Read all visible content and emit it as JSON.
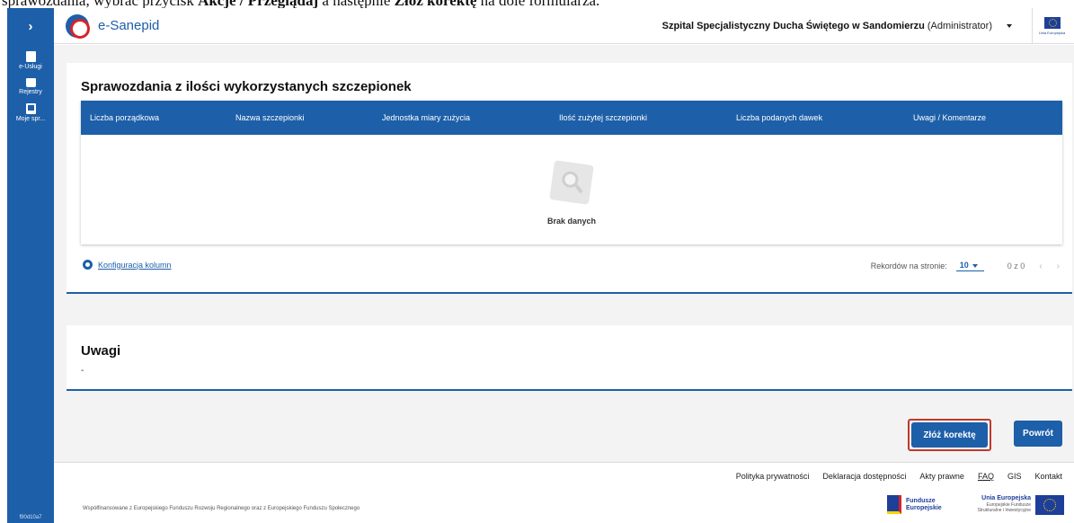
{
  "caption": {
    "pre": "sprawozdania, wybrać przycisk ",
    "bold1": "Akcje / Przeglądaj",
    "mid": " a następnie ",
    "bold2": "Złóż korektę",
    "post": " na dole formularza."
  },
  "sidebar": {
    "expand": "›",
    "items": [
      {
        "label": "e-Usługi",
        "icon": "document-icon"
      },
      {
        "label": "Rejestry",
        "icon": "folder-icon"
      },
      {
        "label": "Moje spr...",
        "icon": "bookmark-icon"
      }
    ],
    "version": "f90d10a7"
  },
  "header": {
    "app_name": "e-Sanepid",
    "org_name": "Szpital Specjalistyczny Ducha Świętego w Sandomierzu",
    "role": "(Administrator)",
    "eu_label": "Unia Europejska"
  },
  "report": {
    "title": "Sprawozdania z ilości wykorzystanych szczepionek",
    "columns": [
      "Liczba porządkowa",
      "Nazwa szczepionki",
      "Jednostka miary zużycia",
      "Ilość zużytej szczepionki",
      "Liczba podanych dawek",
      "Uwagi / Komentarze"
    ],
    "empty_text": "Brak danych",
    "config_label": "Konfiguracja kolumn",
    "per_page_label": "Rekordów na stronie:",
    "per_page_value": "10",
    "range": "0 z 0",
    "prev": "‹",
    "next": "›"
  },
  "notes": {
    "title": "Uwagi",
    "value": "-"
  },
  "actions": {
    "correct_label": "Złóż korektę",
    "back_label": "Powrót"
  },
  "footer": {
    "links": [
      "Polityka prywatności",
      "Deklaracja dostępności",
      "Akty prawne",
      "FAQ",
      "GIS",
      "Kontakt"
    ],
    "note": "Współfinansowane z Europejskiego Funduszu Rozwoju Regionalnego oraz z Europejskiego Funduszu Społecznego",
    "fe_line1": "Fundusze",
    "fe_line2": "Europejskie",
    "ue_line1": "Unia Europejska",
    "ue_line2": "Europejskie Fundusze",
    "ue_line3": "Strukturalne i Inwestycyjne"
  },
  "colors": {
    "primary": "#1d5fa9",
    "highlight": "#c0392b",
    "background": "#f3f3f3"
  }
}
